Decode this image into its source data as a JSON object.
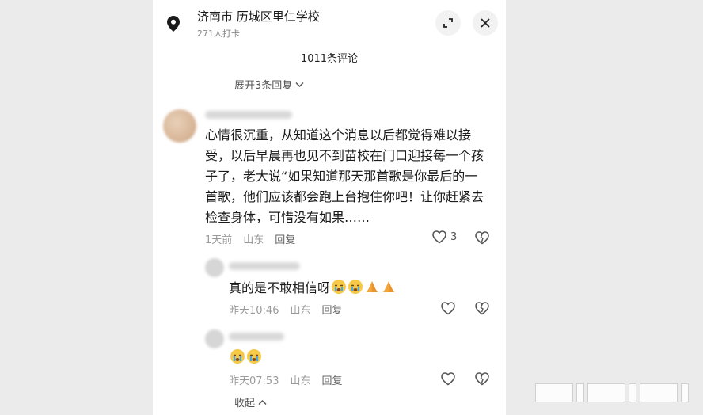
{
  "header": {
    "location_title": "济南市  历城区里仁学校",
    "checkins": "271人打卡",
    "expand_icon": "expand-icon",
    "close_icon": "close-icon"
  },
  "comments_count": "1011条评论",
  "expand_replies": "展开3条回复",
  "comment": {
    "text": "心情很沉重，从知道这个消息以后都觉得难以接受，以后早晨再也见不到苗校在门口迎接每一个孩子了，老大说“如果知道那天那首歌是你最后的一首歌，他们应该都会跑上台抱住你吧！让你赶紧去检查身体，可惜没有如果……",
    "time": "1天前",
    "region": "山东",
    "reply_label": "回复",
    "likes": "3"
  },
  "replies": [
    {
      "text": "真的是不敢相信呀",
      "emojis": [
        "crying-face",
        "crying-face",
        "folded-hands",
        "folded-hands"
      ],
      "time": "昨天10:46",
      "region": "山东",
      "reply_label": "回复"
    },
    {
      "text": "",
      "emojis": [
        "crying-face",
        "crying-face"
      ],
      "time": "昨天07:53",
      "region": "山东",
      "reply_label": "回复"
    }
  ],
  "collapse_label": "收起"
}
